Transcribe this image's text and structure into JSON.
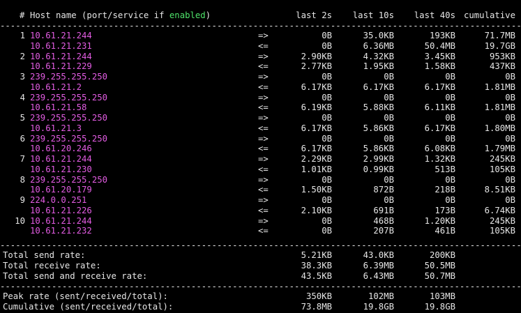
{
  "header": {
    "num": "#",
    "host_prefix": "Host name (port/service if ",
    "host_enabled": "enabled",
    "host_suffix": ")",
    "last2": "last 2s",
    "last10": "last 10s",
    "last40": "last 40s",
    "cumulative": "cumulative"
  },
  "separator": "--------------------------------------------------------------------------------------------------------------------",
  "connections": [
    {
      "num": "1",
      "src": {
        "host": "10.61.21.244",
        "dir": "=>",
        "l2": "0B",
        "l10": "35.0KB",
        "l40": "193KB",
        "cum": "71.7MB"
      },
      "dst": {
        "host": "10.61.21.231",
        "dir": "<=",
        "l2": "0B",
        "l10": "6.36MB",
        "l40": "50.4MB",
        "cum": "19.7GB"
      }
    },
    {
      "num": "2",
      "src": {
        "host": "10.61.21.244",
        "dir": "=>",
        "l2": "2.90KB",
        "l10": "4.32KB",
        "l40": "3.45KB",
        "cum": "953KB"
      },
      "dst": {
        "host": "10.61.21.229",
        "dir": "<=",
        "l2": "2.77KB",
        "l10": "1.95KB",
        "l40": "1.58KB",
        "cum": "437KB"
      }
    },
    {
      "num": "3",
      "src": {
        "host": "239.255.255.250",
        "dir": "=>",
        "l2": "0B",
        "l10": "0B",
        "l40": "0B",
        "cum": "0B"
      },
      "dst": {
        "host": "10.61.21.2",
        "dir": "<=",
        "l2": "6.17KB",
        "l10": "6.17KB",
        "l40": "6.17KB",
        "cum": "1.81MB"
      }
    },
    {
      "num": "4",
      "src": {
        "host": "239.255.255.250",
        "dir": "=>",
        "l2": "0B",
        "l10": "0B",
        "l40": "0B",
        "cum": "0B"
      },
      "dst": {
        "host": "10.61.21.58",
        "dir": "<=",
        "l2": "6.19KB",
        "l10": "5.88KB",
        "l40": "6.11KB",
        "cum": "1.81MB"
      }
    },
    {
      "num": "5",
      "src": {
        "host": "239.255.255.250",
        "dir": "=>",
        "l2": "0B",
        "l10": "0B",
        "l40": "0B",
        "cum": "0B"
      },
      "dst": {
        "host": "10.61.21.3",
        "dir": "<=",
        "l2": "6.17KB",
        "l10": "5.86KB",
        "l40": "6.17KB",
        "cum": "1.80MB"
      }
    },
    {
      "num": "6",
      "src": {
        "host": "239.255.255.250",
        "dir": "=>",
        "l2": "0B",
        "l10": "0B",
        "l40": "0B",
        "cum": "0B"
      },
      "dst": {
        "host": "10.61.20.246",
        "dir": "<=",
        "l2": "6.17KB",
        "l10": "5.86KB",
        "l40": "6.08KB",
        "cum": "1.79MB"
      }
    },
    {
      "num": "7",
      "src": {
        "host": "10.61.21.244",
        "dir": "=>",
        "l2": "2.29KB",
        "l10": "2.99KB",
        "l40": "1.32KB",
        "cum": "245KB"
      },
      "dst": {
        "host": "10.61.21.230",
        "dir": "<=",
        "l2": "1.01KB",
        "l10": "0.99KB",
        "l40": "513B",
        "cum": "105KB"
      }
    },
    {
      "num": "8",
      "src": {
        "host": "239.255.255.250",
        "dir": "=>",
        "l2": "0B",
        "l10": "0B",
        "l40": "0B",
        "cum": "0B"
      },
      "dst": {
        "host": "10.61.20.179",
        "dir": "<=",
        "l2": "1.50KB",
        "l10": "872B",
        "l40": "218B",
        "cum": "8.51KB"
      }
    },
    {
      "num": "9",
      "src": {
        "host": "224.0.0.251",
        "dir": "=>",
        "l2": "0B",
        "l10": "0B",
        "l40": "0B",
        "cum": "0B"
      },
      "dst": {
        "host": "10.61.21.226",
        "dir": "<=",
        "l2": "2.10KB",
        "l10": "691B",
        "l40": "173B",
        "cum": "6.74KB"
      }
    },
    {
      "num": "10",
      "src": {
        "host": "10.61.21.244",
        "dir": "=>",
        "l2": "0B",
        "l10": "468B",
        "l40": "1.20KB",
        "cum": "245KB"
      },
      "dst": {
        "host": "10.61.21.232",
        "dir": "<=",
        "l2": "0B",
        "l10": "207B",
        "l40": "461B",
        "cum": "105KB"
      }
    }
  ],
  "totals": [
    {
      "label": "Total send rate:",
      "l2": "5.21KB",
      "l10": "43.0KB",
      "l40": "200KB"
    },
    {
      "label": "Total receive rate:",
      "l2": "38.3KB",
      "l10": "6.39MB",
      "l40": "50.5MB"
    },
    {
      "label": "Total send and receive rate:",
      "l2": "43.5KB",
      "l10": "6.43MB",
      "l40": "50.7MB"
    }
  ],
  "peaks": [
    {
      "label": "Peak rate (sent/received/total):",
      "l2": "350KB",
      "l10": "102MB",
      "l40": "103MB"
    },
    {
      "label": "Cumulative (sent/received/total):",
      "l2": "73.8MB",
      "l10": "19.8GB",
      "l40": "19.8GB"
    }
  ],
  "colors": {
    "background": "#000000",
    "text": "#e6e6e6",
    "host": "#e25ce2",
    "enabled": "#4ee36a"
  }
}
